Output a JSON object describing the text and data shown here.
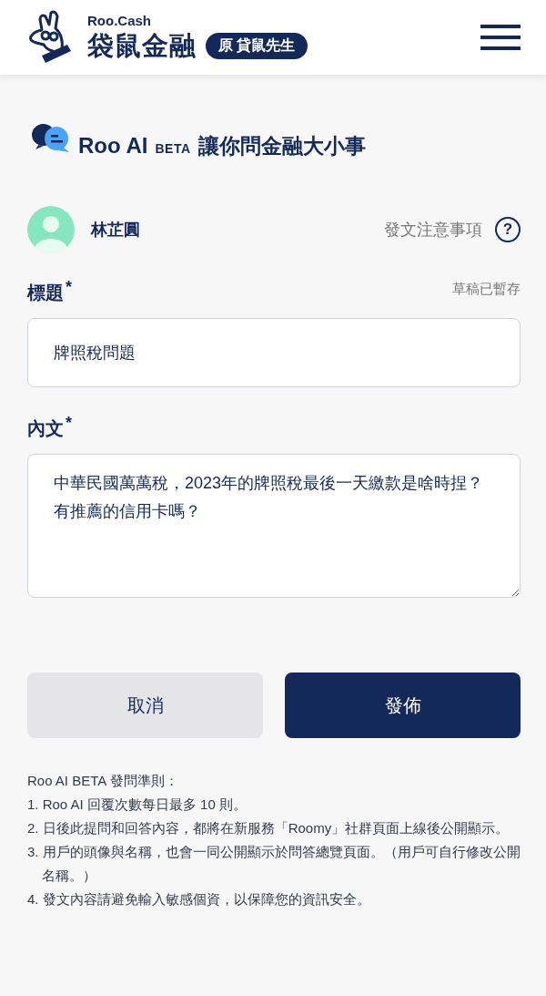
{
  "header": {
    "brand_small": "Roo.Cash",
    "brand_name": "袋鼠金融",
    "badge": "原 貸鼠先生"
  },
  "title": {
    "name": "Roo AI",
    "tag": "BETA",
    "slogan": "讓你問金融大小事"
  },
  "user": {
    "name": "林芷圓",
    "notice_link": "發文注意事項",
    "help_icon": "?"
  },
  "fields": [
    {
      "kind": "input",
      "label": "標題",
      "required_mark": "*",
      "status": "草稿已暫存",
      "value": "牌照稅問題"
    },
    {
      "kind": "textarea",
      "label": "內文",
      "required_mark": "*",
      "value": "中華民國萬萬稅，2023年的牌照稅最後一天繳款是啥時捏？有推薦的信用卡嗎？"
    }
  ],
  "buttons": [
    {
      "label": "取消",
      "kind": "secondary"
    },
    {
      "label": "發佈",
      "kind": "primary"
    }
  ],
  "rules": {
    "heading": "Roo AI BETA 發問準則：",
    "items": [
      "1. Roo AI 回覆次數每日最多 10 則。",
      "2. 日後此提問和回答內容，都將在新服務「Roomy」社群頁面上線後公開顯示。",
      "3. 用戶的頭像與名稱，也會一同公開顯示於問答總覽頁面。（用戶可自行修改公開名稱。）",
      "4. 發文內容請避免輸入敏感個資，以保障您的資訊安全。"
    ]
  }
}
